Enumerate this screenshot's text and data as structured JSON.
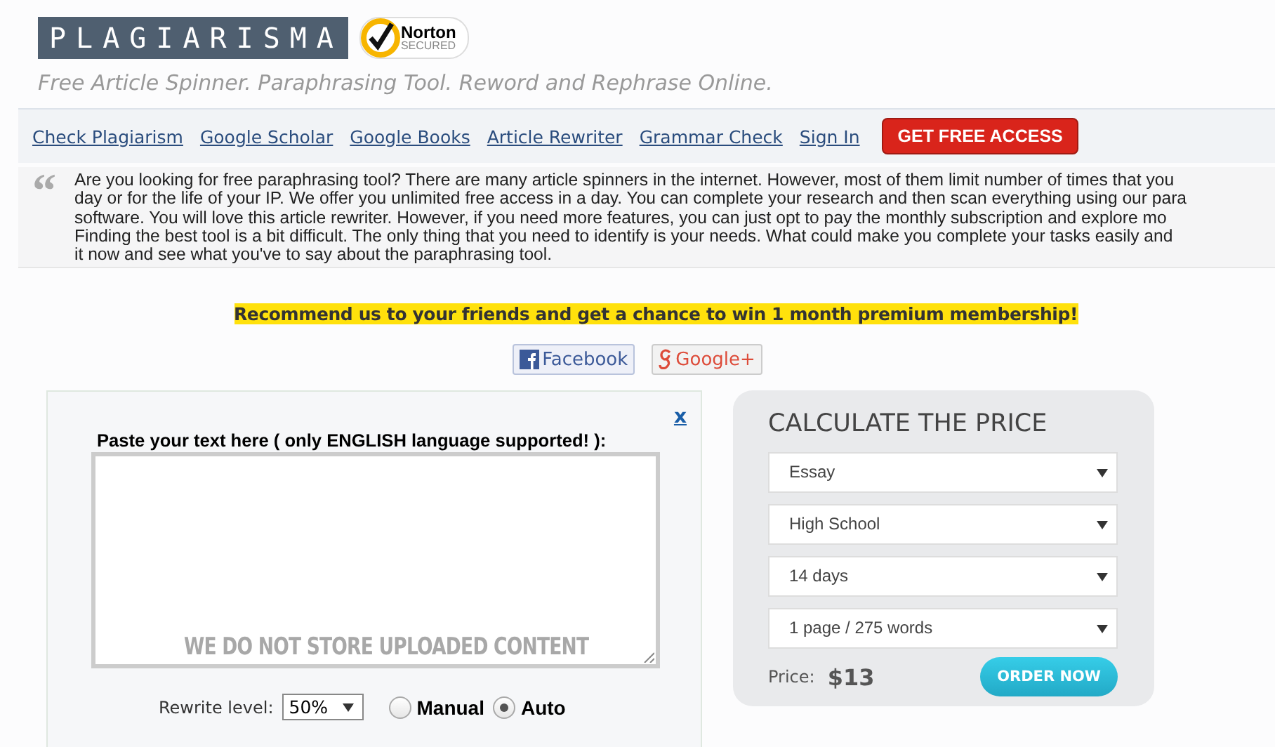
{
  "logo": {
    "text": "PLAGIARISMA",
    "badge_name": "Norton",
    "badge_sub": "SECURED"
  },
  "tagline": "Free Article Spinner. Paraphrasing Tool. Reword and Rephrase Online.",
  "nav": {
    "links": [
      "Check Plagiarism",
      "Google Scholar",
      "Google Books",
      "Article Rewriter",
      "Grammar Check",
      "Sign In"
    ],
    "cta": "GET FREE ACCESS"
  },
  "intro": {
    "quote_mark": "“",
    "lines": [
      "Are you looking for free paraphrasing tool? There are many article spinners in the internet. However, most of them limit number of times that you",
      "day or for the life of your IP. We offer you unlimited free access in a day. You can complete your research and then scan everything using our para",
      "software. You will love this article rewriter. However, if you need more features, you can just opt to pay the monthly subscription and explore mo",
      "Finding the best tool is a bit difficult. The only thing that you need to identify is your needs. What could make you complete your tasks easily and",
      "it now and see what you've to say about the paraphrasing tool."
    ]
  },
  "promo": "Recommend us to your friends and get a chance to win 1 month premium membership!",
  "share": [
    {
      "kind": "facebook",
      "label": "Facebook"
    },
    {
      "kind": "google",
      "label": "Google+"
    }
  ],
  "editor": {
    "close": "x",
    "label": "Paste your text here ( only ENGLISH language supported! ):",
    "watermark": "WE DO NOT STORE UPLOADED CONTENT",
    "rewrite_label": "Rewrite level:",
    "rewrite_value": "50%",
    "modes": [
      {
        "label": "Manual",
        "selected": false
      },
      {
        "label": "Auto",
        "selected": true
      }
    ]
  },
  "price": {
    "title": "CALCULATE THE PRICE",
    "selects": [
      "Essay",
      "High School",
      "14 days",
      "1 page / 275 words"
    ],
    "price_label": "Price:",
    "price": "$13",
    "order": "ORDER NOW"
  }
}
